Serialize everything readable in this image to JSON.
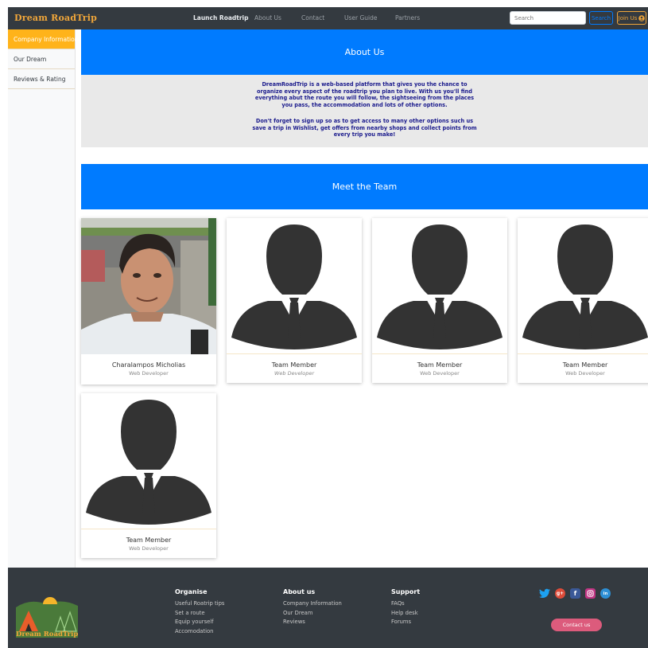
{
  "nav": {
    "brand": "Dream RoadTrip",
    "links": [
      "Launch Roadtrip",
      "About Us",
      "Contact",
      "User Guide",
      "Partners"
    ],
    "search_placeholder": "Search",
    "search_button": "Search",
    "join_button": "Join Us"
  },
  "sidebar": {
    "items": [
      {
        "label": "Company Information",
        "active": true
      },
      {
        "label": "Our Dream",
        "active": false
      },
      {
        "label": "Reviews & Rating",
        "active": false
      }
    ]
  },
  "about": {
    "heading": "About Us",
    "paragraph1": "DreamRoadTrip is a web-based platform that gives you the chance to organize every aspect of the roadtrip you plan to live. With us you'll find everything abut the route you will follow, the sightseeing from the places you pass, the accommodation and lots of other options.",
    "paragraph2": "Don't forget to sign up so as to get access to many other options such us save a trip in Wishlist, get offers from nearby shops and collect points from every trip you make!"
  },
  "team": {
    "heading": "Meet the Team",
    "members": [
      {
        "name": "Charalampos Micholias",
        "role": "Web Developer",
        "photo": "person-photo"
      },
      {
        "name": "Team Member",
        "role": "Web Developer",
        "photo": "silhouette-icon"
      },
      {
        "name": "Team Member",
        "role": "Web Developer",
        "photo": "silhouette-icon"
      },
      {
        "name": "Team Member",
        "role": "Web Developer",
        "photo": "silhouette-icon"
      },
      {
        "name": "Team Member",
        "role": "Web Developer",
        "photo": "silhouette-icon"
      }
    ]
  },
  "footer": {
    "logo_text": "Dream RoadTrip",
    "organise": {
      "title": "Organise",
      "links": [
        "Useful Roatrip tips",
        "Set a route",
        "Equip yourself",
        "Accomodation"
      ]
    },
    "about": {
      "title": "About us",
      "links": [
        "Company Information",
        "Our Dream",
        "Reviews"
      ]
    },
    "support": {
      "title": "Support",
      "links": [
        "FAQs",
        "Help desk",
        "Forums"
      ]
    },
    "social": [
      "twitter-icon",
      "google-plus-icon",
      "facebook-icon",
      "instagram-icon",
      "linkedin-icon"
    ],
    "contact_button": "Contact us"
  },
  "colors": {
    "accent": "#007bff",
    "brand": "#f0a63a",
    "sidebar_active": "#ffb31a",
    "nav_bg": "#343a40",
    "contact_button": "#dc5b7c"
  }
}
